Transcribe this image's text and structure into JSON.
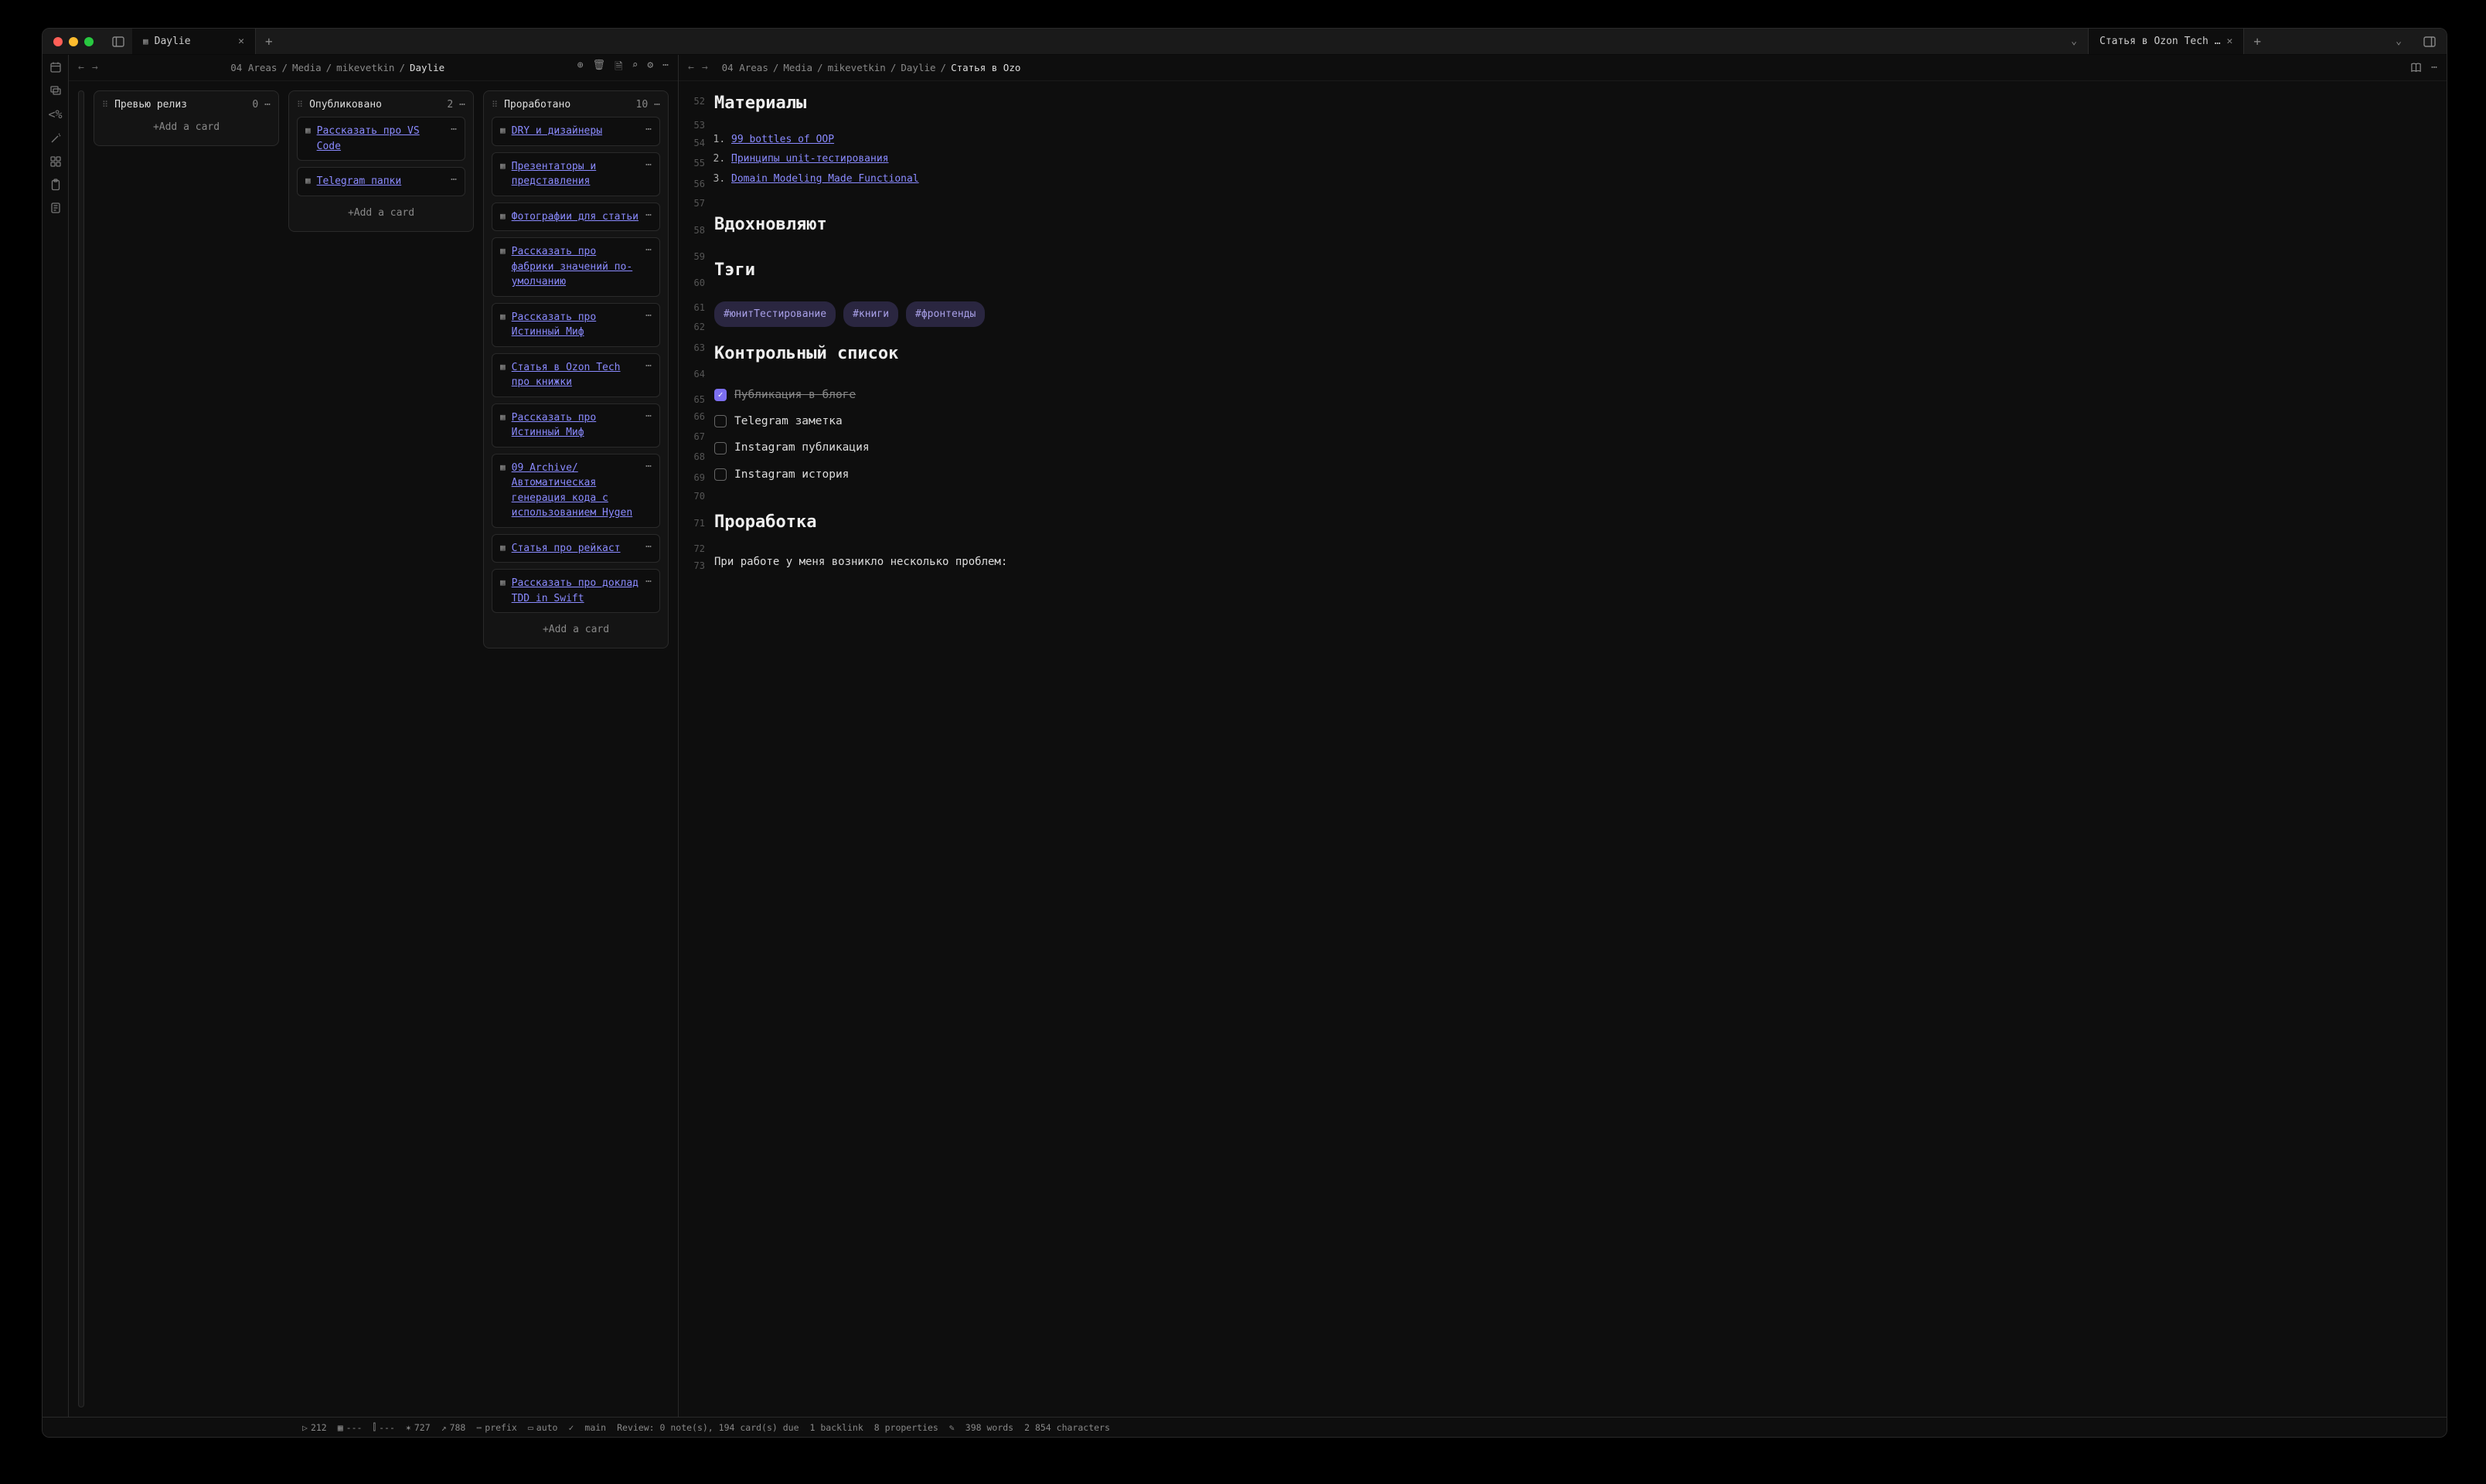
{
  "titlebar": {
    "tabs": [
      {
        "title": "Daylie"
      },
      {
        "title": "Статья в Ozon Tech …"
      }
    ]
  },
  "leftPane": {
    "breadcrumb": [
      "04 Areas",
      "Media",
      "mikevetkin",
      "Daylie"
    ]
  },
  "rightPane": {
    "breadcrumb": [
      "04 Areas",
      "Media",
      "mikevetkin",
      "Daylie",
      "Статья в Ozo"
    ]
  },
  "board": {
    "columns": [
      {
        "title": "Превью релиз",
        "count": "0",
        "cards": []
      },
      {
        "title": "Опубликовано",
        "count": "2",
        "cards": [
          "Рассказать про VS Code",
          "Telegram папки"
        ]
      },
      {
        "title": "Проработано",
        "count": "10",
        "cards": [
          "DRY и дизайнеры",
          "Презентаторы и представления",
          "Фотографии для статьи",
          "Рассказать про фабрики значений по-умолчанию",
          "Рассказать про Истинный Миф",
          "Статья в Ozon Tech про книжки",
          "Рассказать про Истинный Миф",
          "09 Archive/Автоматическая генерация кода с использованием Hygen",
          "Статья про рейкаст",
          "Рассказать про доклад TDD in Swift"
        ]
      }
    ],
    "addCard": "+Add a card"
  },
  "doc": {
    "lines": [
      "52",
      "53",
      "54",
      "55",
      "56",
      "57",
      "58",
      "59",
      "60",
      "61",
      "62",
      "63",
      "64",
      "65",
      "66",
      "67",
      "68",
      "69",
      "70",
      "71",
      "72",
      "73"
    ],
    "h_materials": "Материалы",
    "ol": [
      "99 bottles of OOP",
      "Принципы unit-тестирования",
      "Domain Modeling Made Functional"
    ],
    "h_inspire": "Вдохновляют",
    "h_tags": "Тэги",
    "tags": [
      "#юнитТестирование",
      "#книги",
      "#фронтенды"
    ],
    "h_checklist": "Контрольный список",
    "checklist": [
      {
        "label": "Публикация в блоге",
        "checked": true
      },
      {
        "label": "Telegram заметка",
        "checked": false
      },
      {
        "label": "Instagram публикация",
        "checked": false
      },
      {
        "label": "Instagram история",
        "checked": false
      }
    ],
    "h_work": "Проработка",
    "para": "При работе у меня возникло несколько проблем:"
  },
  "status": {
    "s1": "212",
    "s2": "---",
    "s3": "---",
    "s4": "727",
    "s5": "788",
    "s6": "prefix",
    "s7": "auto",
    "branch": "main",
    "review": "Review: 0 note(s), 194 card(s) due",
    "backlinks": "1 backlink",
    "properties": "8 properties",
    "words": "398 words",
    "chars": "2 854 characters"
  }
}
